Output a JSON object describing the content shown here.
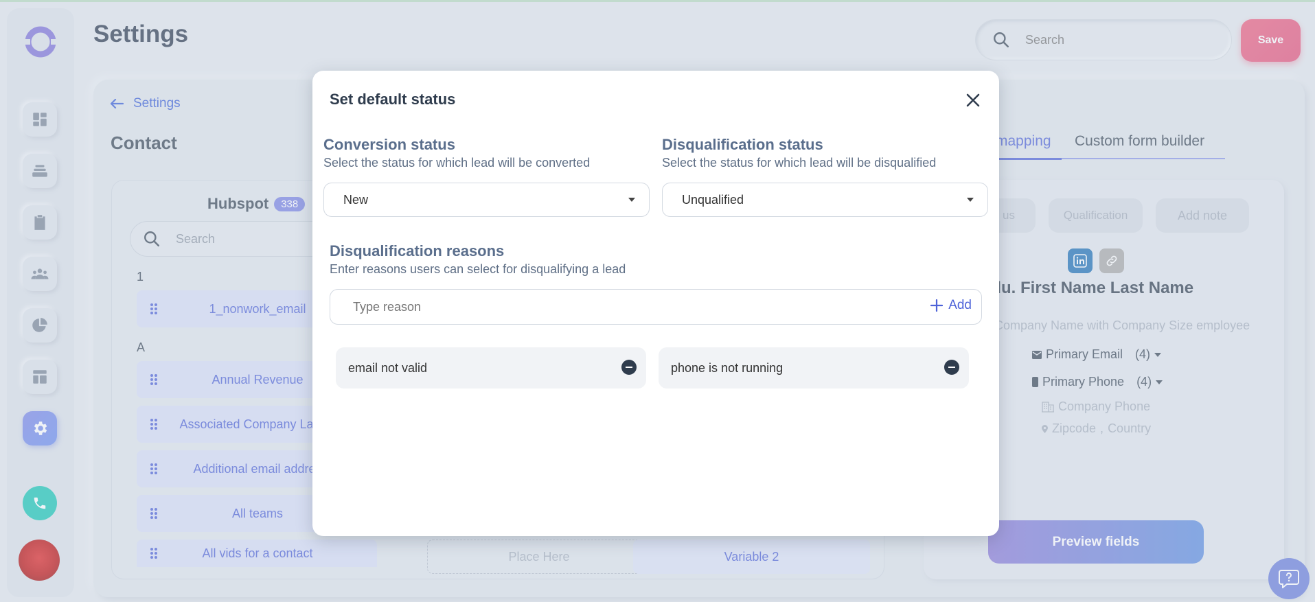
{
  "header": {
    "title": "Settings",
    "search_placeholder": "Search",
    "save_label": "Save"
  },
  "sidebar": {
    "items": [
      {
        "icon": "dashboard-icon"
      },
      {
        "icon": "layers-icon"
      },
      {
        "icon": "clipboard-icon"
      },
      {
        "icon": "team-icon"
      },
      {
        "icon": "pie-chart-icon"
      },
      {
        "icon": "layout-icon"
      },
      {
        "icon": "gear-icon",
        "active": true
      }
    ]
  },
  "breadcrumb": {
    "back_label": "Settings"
  },
  "section_title": "Contact",
  "fields": {
    "source_name": "Hubspot",
    "count": "338",
    "search_placeholder": "Search",
    "groups": [
      {
        "label": "1",
        "items": [
          "1_nonwork_email"
        ]
      },
      {
        "label": "A",
        "items": [
          "Annual Revenue",
          "Associated Company Last U",
          "Additional email addres",
          "All teams",
          "All vids for a contact"
        ]
      }
    ],
    "drop_zone": "Place Here",
    "variable": "Variable 2"
  },
  "tabs": {
    "mapping": "mapping",
    "form_builder": "Custom form builder"
  },
  "preview": {
    "pills": [
      "us",
      "Qualification",
      "Add note"
    ],
    "name": "alu. First Name Last Name",
    "company": "t Company Name with Company Size employee",
    "email_label": "Primary Email",
    "email_count": "(4)",
    "phone_label": "Primary Phone",
    "phone_count": "(4)",
    "company_phone": "Company Phone",
    "zipcode": "Zipcode",
    "separator": ",",
    "country": "Country",
    "button": "Preview fields"
  },
  "modal": {
    "title": "Set default status",
    "conversion": {
      "heading": "Conversion status",
      "sub": "Select the status for which lead will be converted",
      "value": "New"
    },
    "disqualification": {
      "heading": "Disqualification status",
      "sub": "Select the status for which lead will be disqualified",
      "value": "Unqualified"
    },
    "reasons": {
      "heading": "Disqualification reasons",
      "sub": "Enter reasons users can select for disqualifying a lead",
      "placeholder": "Type reason",
      "add_label": "Add",
      "items": [
        "email not valid",
        "phone is not running"
      ]
    }
  },
  "colors": {
    "accent": "#4d62d8",
    "save": "#e4527c",
    "phone": "#17c7b5",
    "active_nav": "#7381ea"
  }
}
